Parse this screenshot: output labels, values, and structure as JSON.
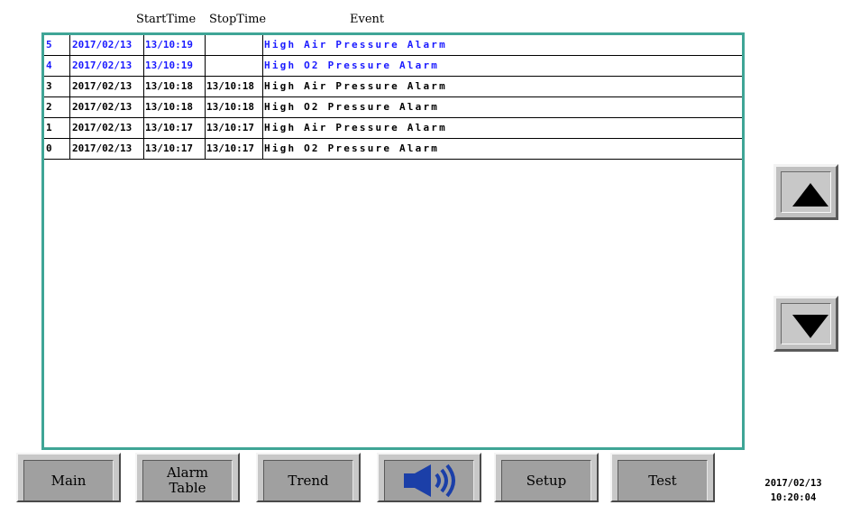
{
  "header": {
    "start_time": "StartTime",
    "stop_time": "StopTime",
    "event": "Event"
  },
  "colors": {
    "active": "#1a1aff",
    "cleared": "#000000",
    "frame": "#3fa596"
  },
  "alarms": [
    {
      "id": "5",
      "date": "2017/02/13",
      "start": "13/10:19",
      "stop": "",
      "event": "High Air Pressure Alarm",
      "status": "active"
    },
    {
      "id": "4",
      "date": "2017/02/13",
      "start": "13/10:19",
      "stop": "",
      "event": "High O2 Pressure Alarm",
      "status": "active"
    },
    {
      "id": "3",
      "date": "2017/02/13",
      "start": "13/10:18",
      "stop": "13/10:18",
      "event": "High Air Pressure Alarm",
      "status": "cleared"
    },
    {
      "id": "2",
      "date": "2017/02/13",
      "start": "13/10:18",
      "stop": "13/10:18",
      "event": "High O2 Pressure Alarm",
      "status": "cleared"
    },
    {
      "id": "1",
      "date": "2017/02/13",
      "start": "13/10:17",
      "stop": "13/10:17",
      "event": "High Air Pressure Alarm",
      "status": "cleared"
    },
    {
      "id": "0",
      "date": "2017/02/13",
      "start": "13/10:17",
      "stop": "13/10:17",
      "event": "High O2 Pressure Alarm",
      "status": "cleared"
    }
  ],
  "side": {
    "up_icon": "arrow-up-icon",
    "down_icon": "arrow-down-icon"
  },
  "nav": {
    "main": "Main",
    "alarm_table_line1": "Alarm",
    "alarm_table_line2": "Table",
    "trend": "Trend",
    "sound_icon": "speaker-icon",
    "setup": "Setup",
    "test": "Test"
  },
  "datetime": {
    "date": "2017/02/13",
    "time": "10:20:04"
  }
}
